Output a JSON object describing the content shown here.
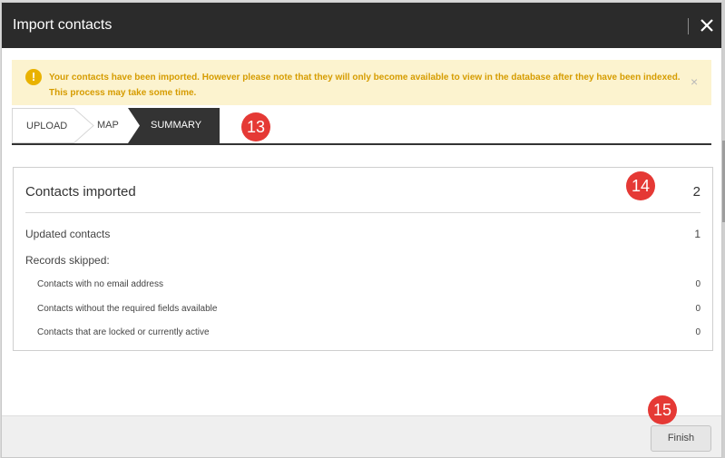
{
  "dialog": {
    "title": "Import contacts",
    "close_icon": "close-icon"
  },
  "alert": {
    "icon": "warning-icon",
    "icon_glyph": "!",
    "line1": "Your contacts have been imported. However please note that they will only become available to view in the database after they have been indexed.",
    "line2": "This process may take some time.",
    "close_glyph": "×"
  },
  "steps": [
    {
      "label": "UPLOAD",
      "active": false
    },
    {
      "label": "MAP",
      "active": false
    },
    {
      "label": "SUMMARY",
      "active": true
    }
  ],
  "markers": [
    "13",
    "14",
    "15"
  ],
  "summary": {
    "heading": "Contacts imported",
    "heading_value": "2",
    "updated_label": "Updated contacts",
    "updated_value": "1",
    "skipped_label": "Records skipped:",
    "skipped": [
      {
        "label": "Contacts with no email address",
        "value": "0"
      },
      {
        "label": "Contacts without the required fields available",
        "value": "0"
      },
      {
        "label": "Contacts that are locked or currently active",
        "value": "0"
      }
    ]
  },
  "footer": {
    "finish_label": "Finish"
  },
  "colors": {
    "titlebar": "#2b2b2b",
    "alert_bg": "#fcf3cf",
    "alert_text": "#d69c00",
    "marker": "#e53935",
    "step_active": "#333333"
  }
}
